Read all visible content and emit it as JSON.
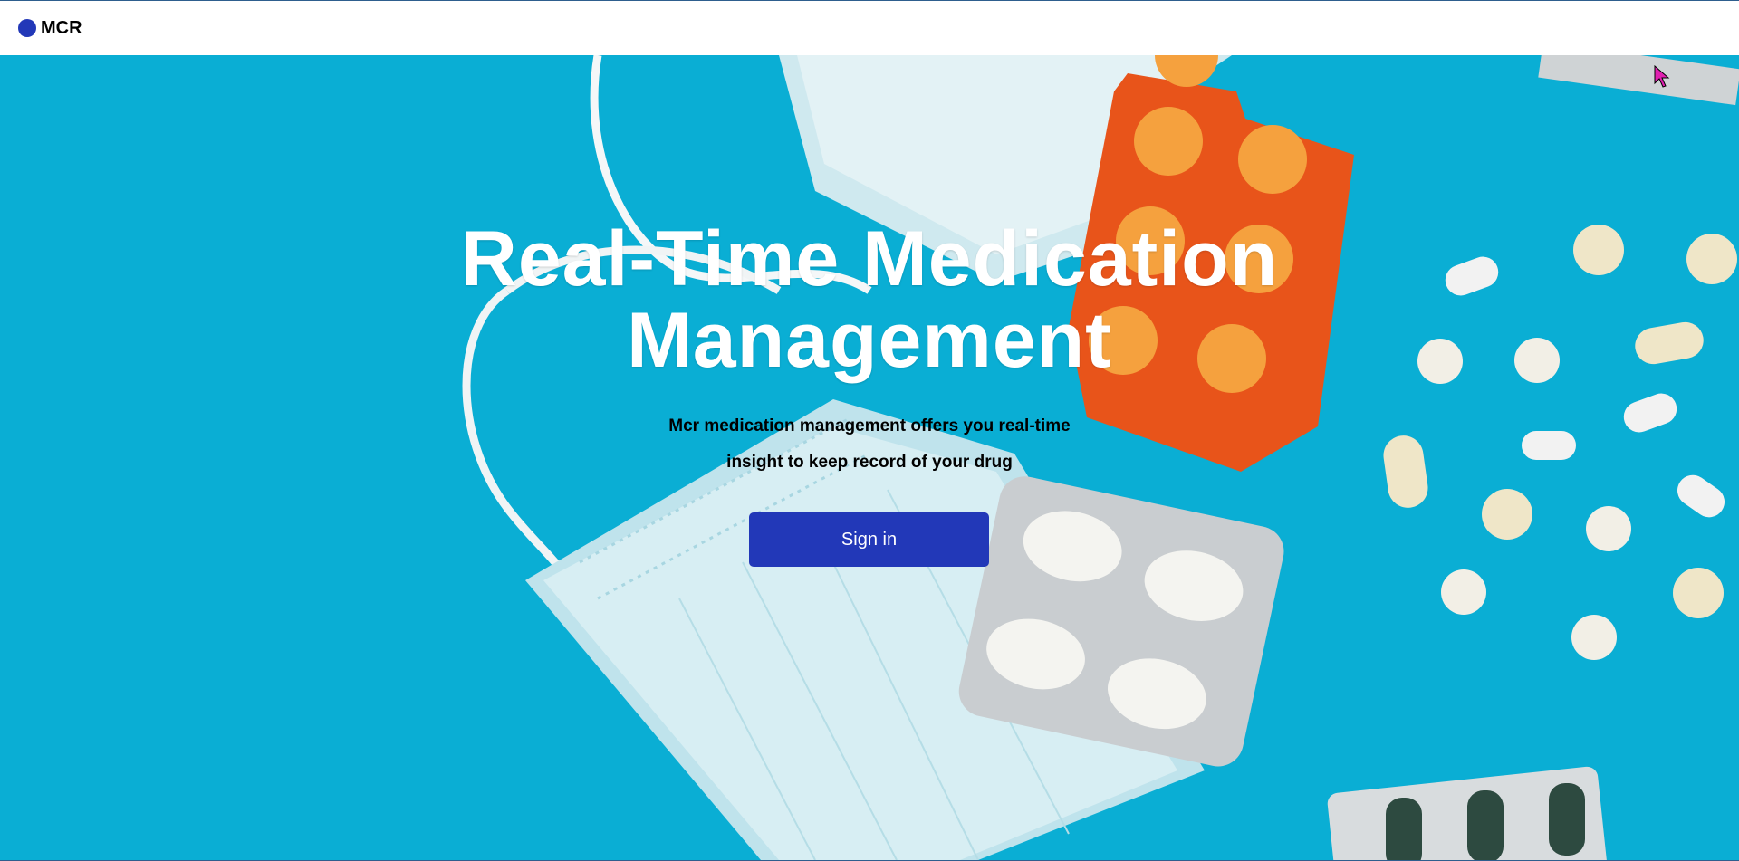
{
  "app": {
    "logo_text": "MCR",
    "brand_color": "#2238b8"
  },
  "hero": {
    "background_color": "#0aaed4",
    "headline_line1": "Real-Time Medication",
    "headline_line2": "Management",
    "subtext_line1": "Mcr medication management offers you real-time",
    "subtext_line2": "insight to keep record of your drug",
    "signin_label": "Sign in",
    "background_image": "medical-mask-and-pills-photo"
  },
  "icons": {
    "logo": "circle-logo-icon",
    "cursor": "mouse-pointer-icon"
  }
}
